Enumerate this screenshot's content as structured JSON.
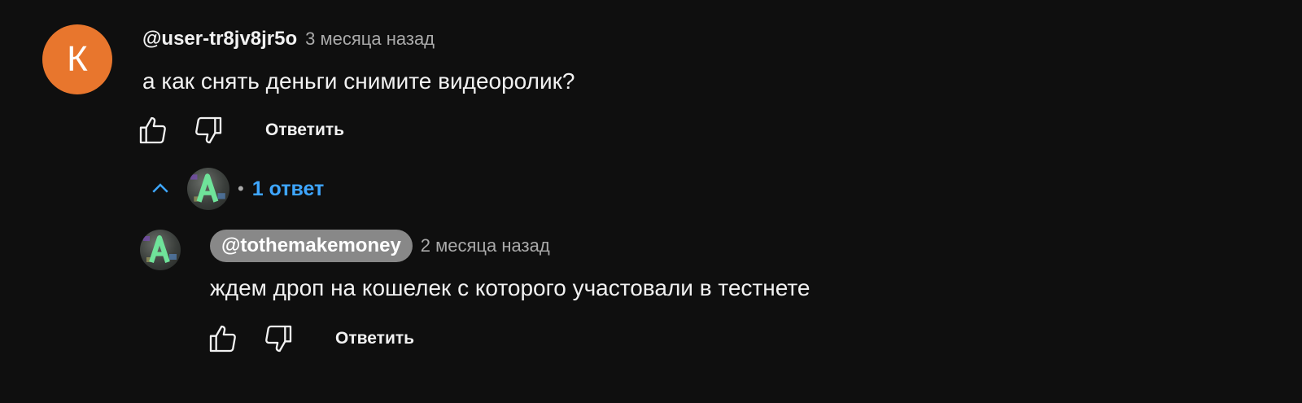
{
  "comment": {
    "avatar_letter": "К",
    "author": "@user-tr8jv8jr5o",
    "time": "3 месяца назад",
    "text": "а как снять деньги снимите видеоролик?",
    "reply_label": "Ответить",
    "avatar_color": "#e8762d"
  },
  "replies_toggle": {
    "dot": "•",
    "count_label": "1 ответ",
    "accent_color": "#3ea6ff"
  },
  "reply": {
    "author": "@tothemakemoney",
    "time": "2 месяца назад",
    "text": "ждем дроп на кошелек с которого участовали в тестнете",
    "reply_label": "Ответить"
  },
  "icons": {
    "like": "thumbs-up-icon",
    "dislike": "thumbs-down-icon",
    "collapse": "chevron-up-icon"
  }
}
